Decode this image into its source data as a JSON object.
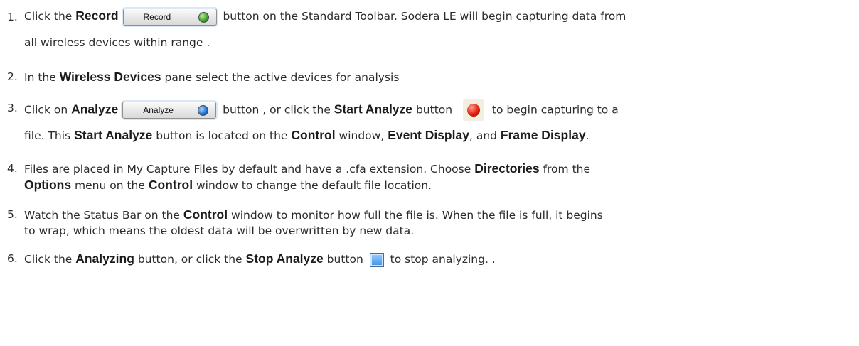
{
  "steps": [
    {
      "number": "1.",
      "segments": [
        "Click the ",
        "Record",
        "",
        " button on the Standard Toolbar. Sodera LE will begin capturing data from",
        "all wireless devices within range ."
      ],
      "button_label": "Record"
    },
    {
      "number": "2.",
      "segments": [
        "In the ",
        "Wireless Devices",
        " pane select the active devices for analysis"
      ]
    },
    {
      "number": "3.",
      "segments": [
        "Click on ",
        "Analyze",
        " button , or click the ",
        "Start Analyze",
        " button ",
        " to begin capturing to a",
        "file.  This ",
        "Start Analyze",
        " button is located on the ",
        "Control",
        " window, ",
        "Event Display",
        ", and ",
        "Frame Display",
        "."
      ],
      "button_label": "Analyze"
    },
    {
      "number": "4.",
      "segments": [
        "Files are placed in My Capture Files by default and have a .cfa extension. Choose ",
        "Directories",
        " from the",
        "Options",
        " menu on the ",
        "Control",
        " window to change the default file location."
      ]
    },
    {
      "number": "5.",
      "segments": [
        "Watch the Status Bar on the ",
        "Control",
        " window to monitor how full the file is. When the file is full, it begins",
        "to wrap, which means the oldest data will be overwritten by new data."
      ]
    },
    {
      "number": "6.",
      "segments": [
        "Click the ",
        "Analyzing",
        " button, or click the ",
        "Stop Analyze",
        " button ",
        " to stop analyzing. ."
      ]
    }
  ],
  "colors": {
    "record_led": "#3e9b22",
    "analyze_led": "#1e6fd0",
    "start_icon": "#e02010",
    "stop_icon": "#3a8ee8"
  }
}
